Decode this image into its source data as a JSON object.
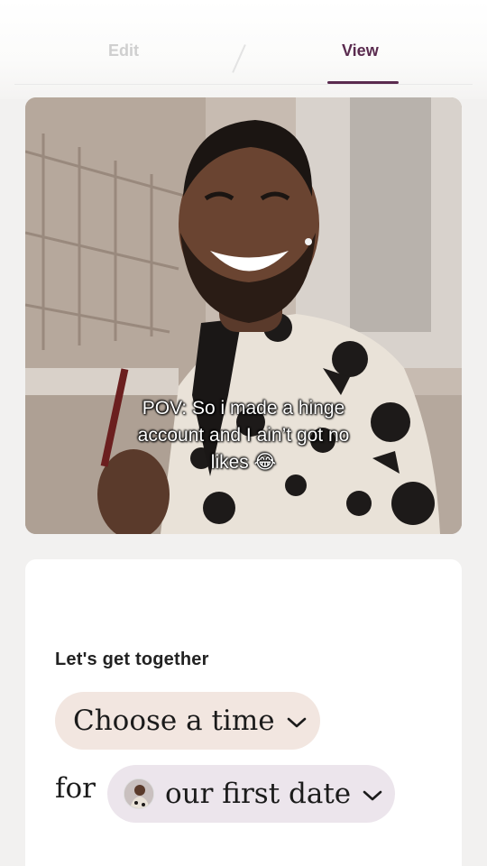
{
  "tabs": {
    "edit": "Edit",
    "view": "View",
    "active": "View",
    "accent_color": "#5a2b4f"
  },
  "photo": {
    "caption_lines": [
      "POV: So i made a hinge",
      "account and I ain’t got no",
      "likes 😂"
    ]
  },
  "prompt_card": {
    "label": "Let's get together",
    "time_pill": "Choose a time",
    "connector": "for",
    "date_pill": "our first date",
    "chevron_icon": "chevron-down-icon"
  }
}
